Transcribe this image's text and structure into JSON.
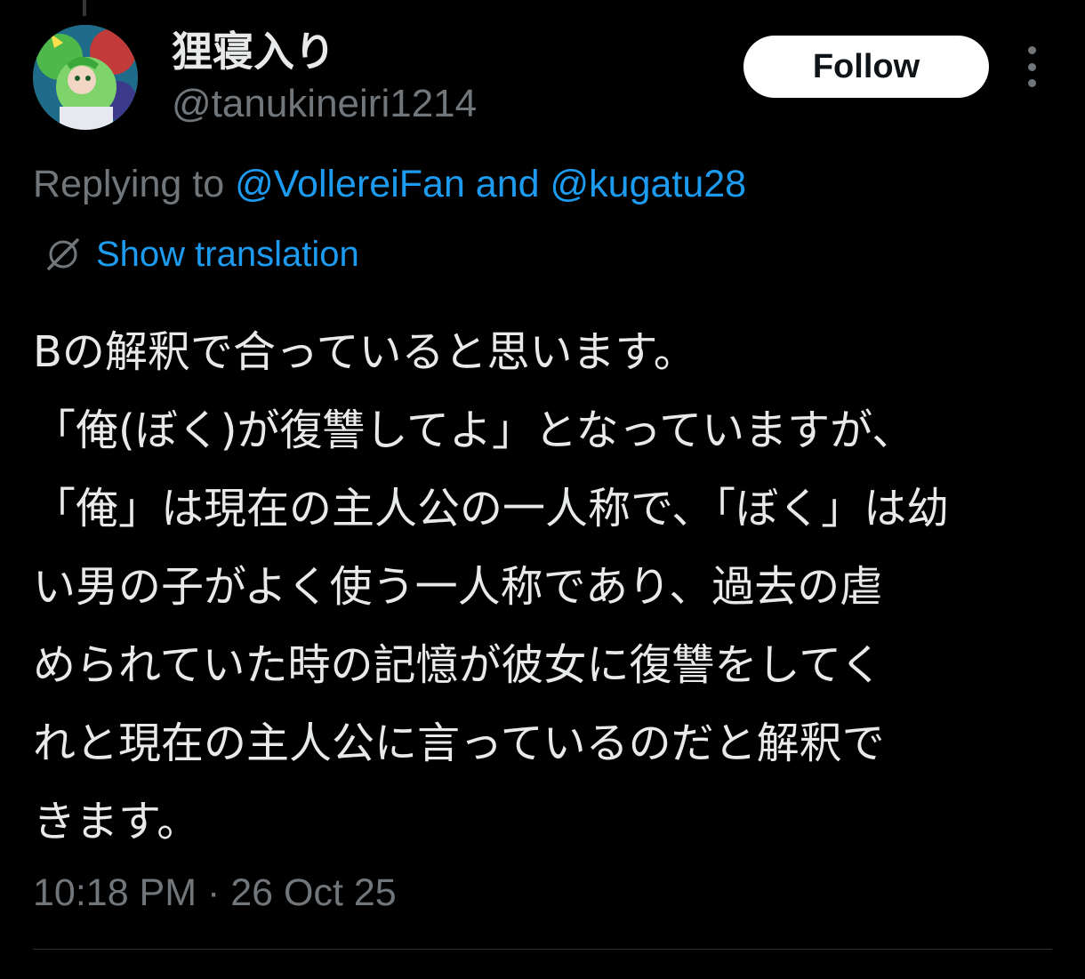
{
  "colors": {
    "background": "#000000",
    "primary_text": "#e7e9ea",
    "secondary_text": "#71767b",
    "link": "#1d9bf0",
    "follow_bg": "#ffffff",
    "follow_text": "#0f1419"
  },
  "author": {
    "display_name": "狸寝入り",
    "handle": "@tanukineiri1214",
    "avatar_icon": "avatar-image"
  },
  "actions": {
    "follow_label": "Follow",
    "more_icon": "more-vertical-icon"
  },
  "reply": {
    "prefix": "Replying to ",
    "mention_1": "@VollereiFan",
    "conjunction": " and ",
    "mention_2": "@kugatu28"
  },
  "translation": {
    "icon": "globe-icon",
    "label": "Show translation"
  },
  "tweet": {
    "lines": [
      "Bの解釈で合っていると思います。",
      "「俺(ぼく)が復讐してよ」となっていますが、",
      "「俺」は現在の主人公の一人称で、「ぼく」は幼",
      "い男の子がよく使う一人称であり、過去の虐",
      "められていた時の記憶が彼女に復讐をしてく",
      "れと現在の主人公に言っているのだと解釈で",
      "きます。"
    ]
  },
  "meta": {
    "timestamp": "10:18 PM · 26 Oct 25"
  }
}
